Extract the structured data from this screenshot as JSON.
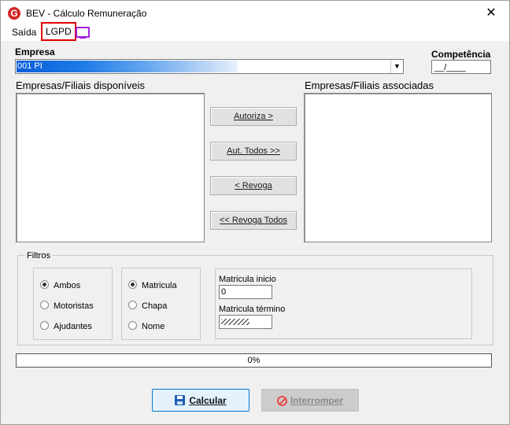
{
  "window": {
    "title": "BEV - Cálculo Remuneração",
    "logo_letter": "G"
  },
  "menu": {
    "saida": "Saída",
    "lgpd": "LGPD"
  },
  "icons": {
    "app": "app-logo-icon",
    "close": "close-icon",
    "monitor": "monitor-icon",
    "save": "save-icon",
    "stop": "stop-icon"
  },
  "colors": {
    "lgpd_highlight": "#e00000",
    "monitor_icon": "#a020e0",
    "selection": "#0a5ed8",
    "primary_border": "#0078d7"
  },
  "empresa": {
    "label": "Empresa",
    "selected_value": "001 PI"
  },
  "competencia": {
    "label": "Competência",
    "value": "__/____"
  },
  "lists": {
    "available_label": "Empresas/Filiais disponíveis",
    "associated_label": "Empresas/Filiais associadas"
  },
  "actions": {
    "autoriza": "Autoriza >",
    "aut_todos": "Aut. Todos >>",
    "revoga": "< Revoga",
    "revoga_todos": "<< Revoga Todos"
  },
  "filtros": {
    "label": "Filtros",
    "tipo": [
      {
        "label": "Ambos",
        "selected": true
      },
      {
        "label": "Motoristas",
        "selected": false
      },
      {
        "label": "Ajudantes",
        "selected": false
      }
    ],
    "ordem": [
      {
        "label": "Matricula",
        "selected": true
      },
      {
        "label": "Chapa",
        "selected": false
      },
      {
        "label": "Nome",
        "selected": false
      }
    ],
    "matricula_inicio_label": "Matricula inicio",
    "matricula_inicio_value": "0",
    "matricula_termino_label": "Matricula término"
  },
  "progress": {
    "text": "0%",
    "value": 0
  },
  "footer": {
    "calcular": "Calcular",
    "interromper": "Interromper"
  }
}
